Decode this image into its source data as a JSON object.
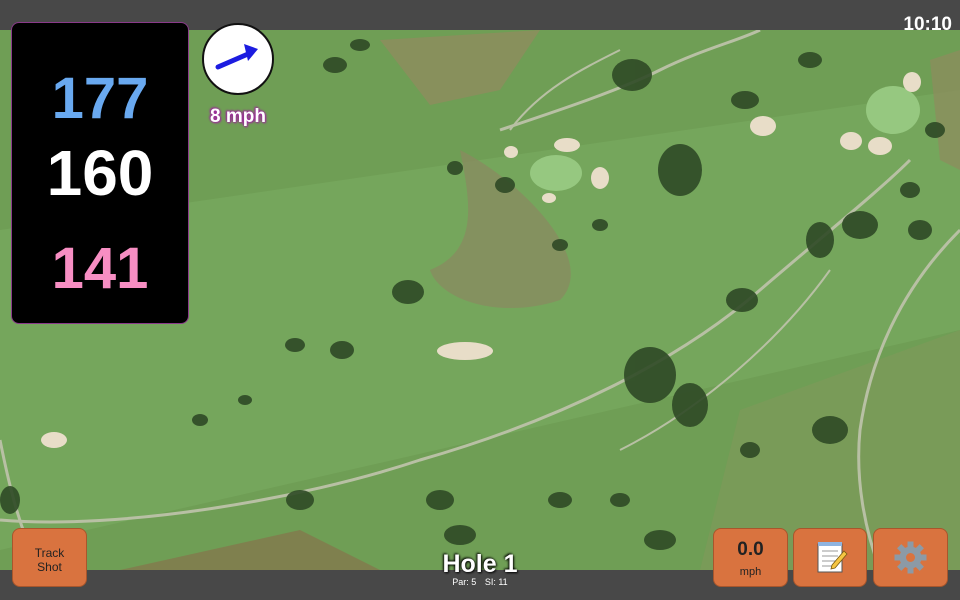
{
  "status": {
    "time": "10:10"
  },
  "distances": {
    "back": "177",
    "middle": "160",
    "front": "141",
    "colors": {
      "back": "#69a9f0",
      "middle": "#ffffff",
      "front": "#f78ec3"
    }
  },
  "wind": {
    "speed_label": "8 mph",
    "arrow_color": "#1c1ce0",
    "direction_icon": "arrow-right-icon"
  },
  "hole": {
    "title": "Hole 1",
    "par_label": "Par: 5",
    "si_label": "SI: 11"
  },
  "buttons": {
    "track_shot_line1": "Track",
    "track_shot_line2": "Shot",
    "speed_value": "0.0",
    "speed_unit": "mph",
    "notes_icon": "notepad-icon",
    "settings_icon": "gear-icon"
  },
  "theme": {
    "button_color": "#d9733f",
    "bar_color": "#484848"
  }
}
